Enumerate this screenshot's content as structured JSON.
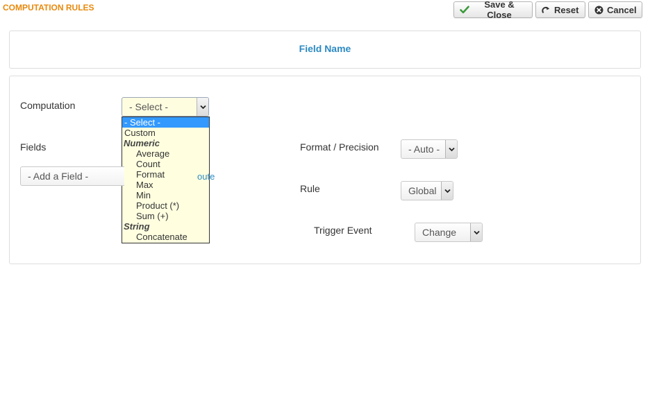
{
  "header": {
    "title": "COMPUTATION RULES"
  },
  "toolbar": {
    "save_close": "Save & Close",
    "reset": "Reset",
    "cancel": "Cancel"
  },
  "field_name_panel": {
    "title": "Field Name"
  },
  "form": {
    "computation": {
      "label": "Computation",
      "value": "- Select -",
      "options": {
        "select": "- Select -",
        "custom": "Custom",
        "numeric_group": "Numeric",
        "average": "Average",
        "count": "Count",
        "format": "Format",
        "max": "Max",
        "min": "Min",
        "product": "Product (*)",
        "sum": "Sum (+)",
        "string_group": "String",
        "concatenate": "Concatenate"
      }
    },
    "fields": {
      "label": "Fields",
      "add_field": "- Add a Field -",
      "link_fragment": "oute"
    },
    "format_precision": {
      "label": "Format / Precision",
      "value": "- Auto -"
    },
    "rule": {
      "label": "Rule",
      "value": "Global"
    },
    "trigger_event": {
      "label": "Trigger Event",
      "value": "Change"
    }
  },
  "colors": {
    "heading": "#e8890c",
    "link": "#2c8ac2",
    "dropdown_bg": "#ffffe0",
    "selected_option": "#3399ff"
  },
  "icons": {
    "save": "check-icon",
    "reset": "redo-icon",
    "cancel": "cancel-circle-icon",
    "select_arrow": "chevron-down-icon"
  }
}
